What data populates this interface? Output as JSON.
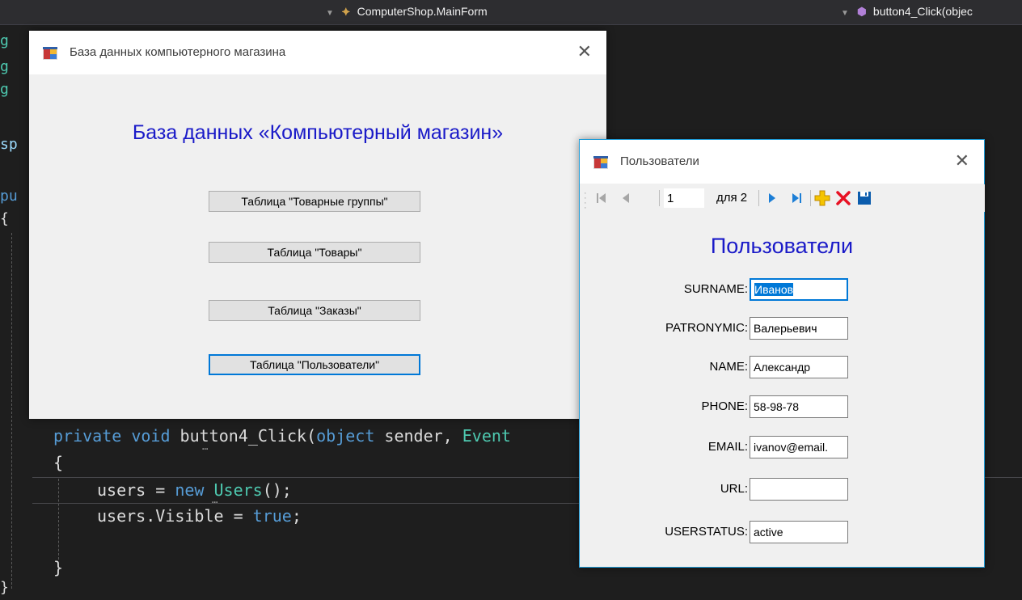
{
  "vs": {
    "class_combo": "ComputerShop.MainForm",
    "method_combo": "button4_Click(objec",
    "gutter": [
      "g",
      "g",
      "g",
      "sp",
      "pu",
      "{",
      "}"
    ],
    "code": {
      "sig_mod": "private",
      "sig_void": "void",
      "sig_name": " button4_Click(",
      "sig_obj": "object",
      "sig_rest": " sender, ",
      "sig_evt": "Event",
      "brace_open": "{",
      "line1_a": "users = ",
      "line1_new": "new",
      "line1_type": " Users",
      "line1_b": "();",
      "line2_a": "users.Visible = ",
      "line2_true": "true",
      "line2_b": ";",
      "brace_close": "}"
    }
  },
  "main_form": {
    "title": "База данных компьютерного магазина",
    "heading": "База данных «Компьютерный магазин»",
    "buttons": [
      "Таблица \"Товарные группы\"",
      "Таблица \"Товары\"",
      "Таблица \"Заказы\"",
      "Таблица \"Пользователи\""
    ]
  },
  "users_form": {
    "title": "Пользователи",
    "heading": "Пользователи",
    "navigator": {
      "position": "1",
      "of_label": "для 2"
    },
    "fields": [
      {
        "label": "SURNAME:",
        "value": "Иванов"
      },
      {
        "label": "PATRONYMIC:",
        "value": "Валерьевич"
      },
      {
        "label": "NAME:",
        "value": "Александр"
      },
      {
        "label": "PHONE:",
        "value": "58-98-78"
      },
      {
        "label": "EMAIL:",
        "value": "ivanov@email."
      },
      {
        "label": "URL:",
        "value": ""
      },
      {
        "label": "USERSTATUS:",
        "value": "active"
      }
    ]
  },
  "colors": {
    "heading_blue": "#1a1ac8",
    "focus_blue": "#0078d7",
    "editor_bg": "#1e1e1e",
    "delete_red": "#e81123",
    "add_yellow": "#f5c400"
  },
  "icons": [
    "app-window-icon",
    "move-first-icon",
    "move-previous-icon",
    "move-next-icon",
    "move-last-icon",
    "add-new-icon",
    "delete-icon",
    "save-icon",
    "close-icon"
  ]
}
